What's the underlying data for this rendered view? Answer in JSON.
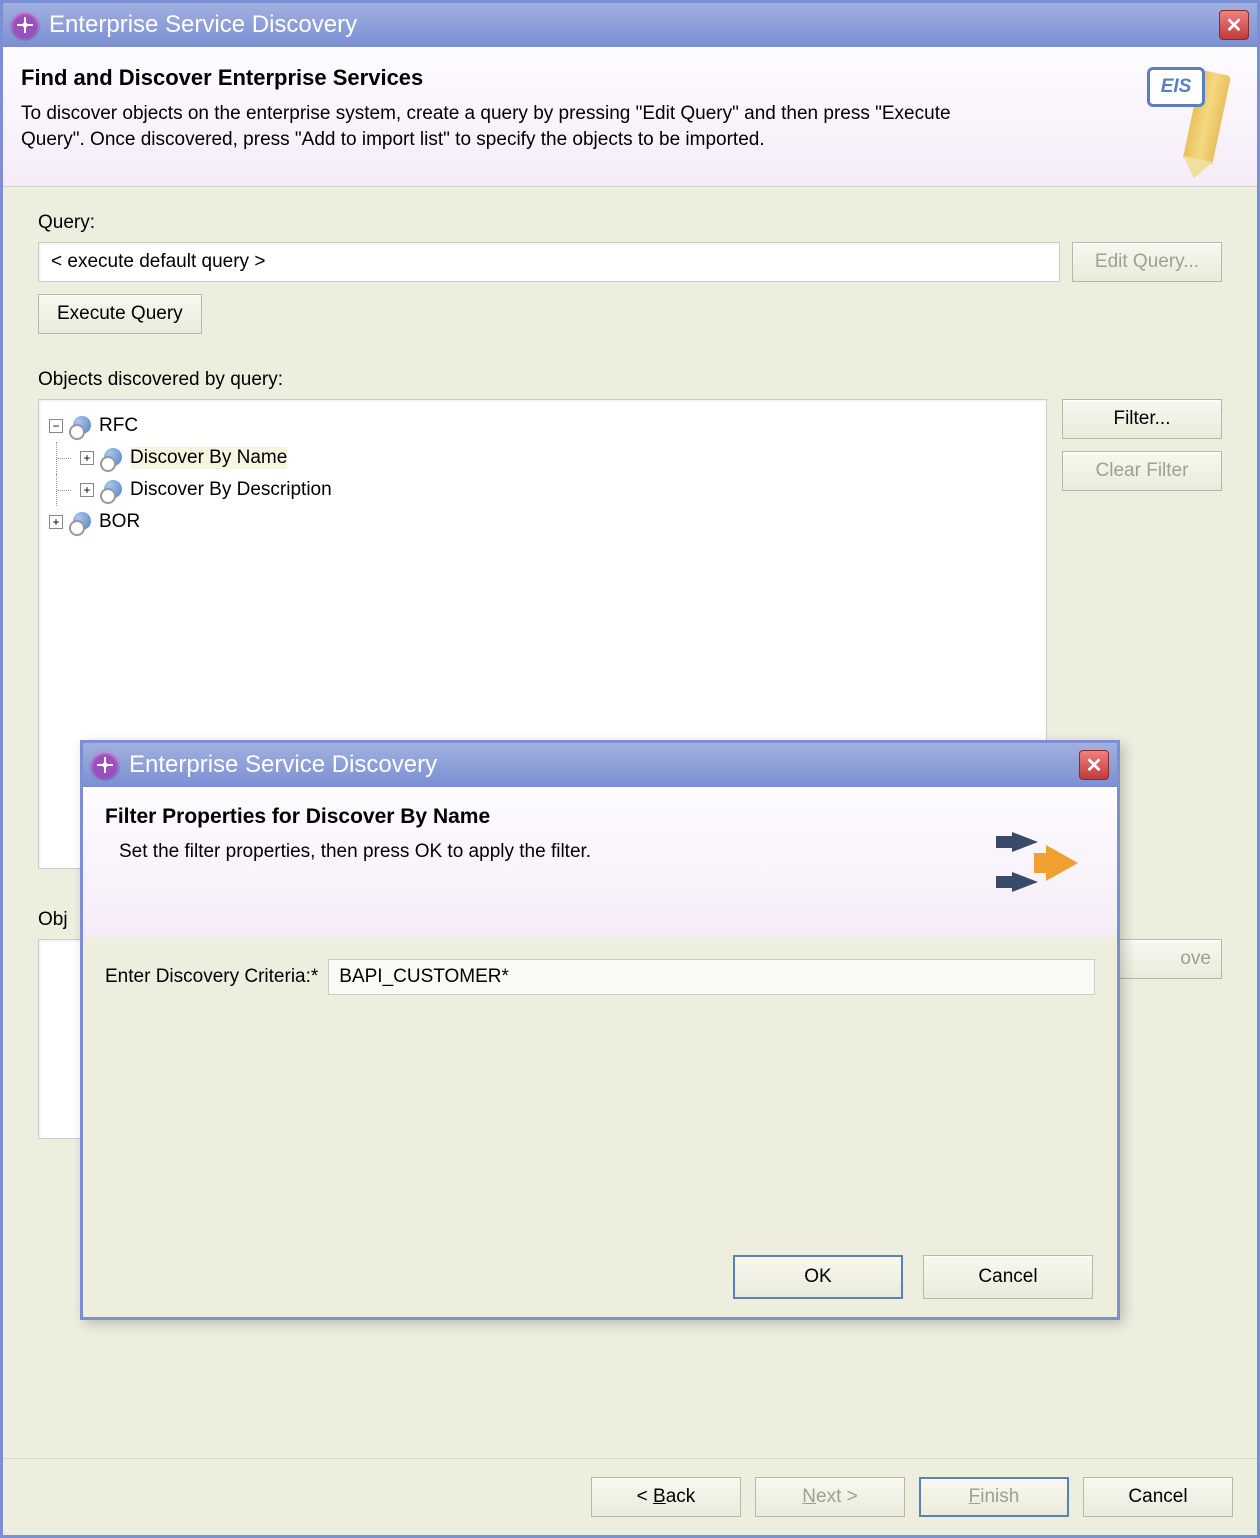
{
  "main": {
    "title": "Enterprise Service Discovery",
    "banner": {
      "heading": "Find and Discover Enterprise Services",
      "desc": "To discover objects on the enterprise system, create a query by pressing \"Edit Query\" and then press \"Execute Query\". Once discovered, press \"Add to import list\" to specify the objects to be imported.",
      "eis": "EIS"
    },
    "query_label": "Query:",
    "query_value": "< execute default query >",
    "edit_query": "Edit Query...",
    "execute_query": "Execute Query",
    "discovered_label": "Objects discovered by query:",
    "tree": {
      "rfc": "RFC",
      "by_name": "Discover By Name",
      "by_desc": "Discover By Description",
      "bor": "BOR"
    },
    "filter_btn": "Filter...",
    "clear_filter_btn": "Clear Filter",
    "import_label": "Obj",
    "remove_btn_fragment": "ove",
    "footer": {
      "back_prefix": "< ",
      "back_mn": "B",
      "back_suffix": "ack",
      "next_mn": "N",
      "next_suffix": "ext >",
      "finish_mn": "F",
      "finish_suffix": "inish",
      "cancel": "Cancel"
    }
  },
  "modal": {
    "title": "Enterprise Service Discovery",
    "heading": "Filter Properties for Discover By Name",
    "desc": "Set the filter properties, then press OK to apply the filter.",
    "criteria_label": "Enter Discovery Criteria:*",
    "criteria_value": "BAPI_CUSTOMER*",
    "ok": "OK",
    "cancel": "Cancel"
  }
}
